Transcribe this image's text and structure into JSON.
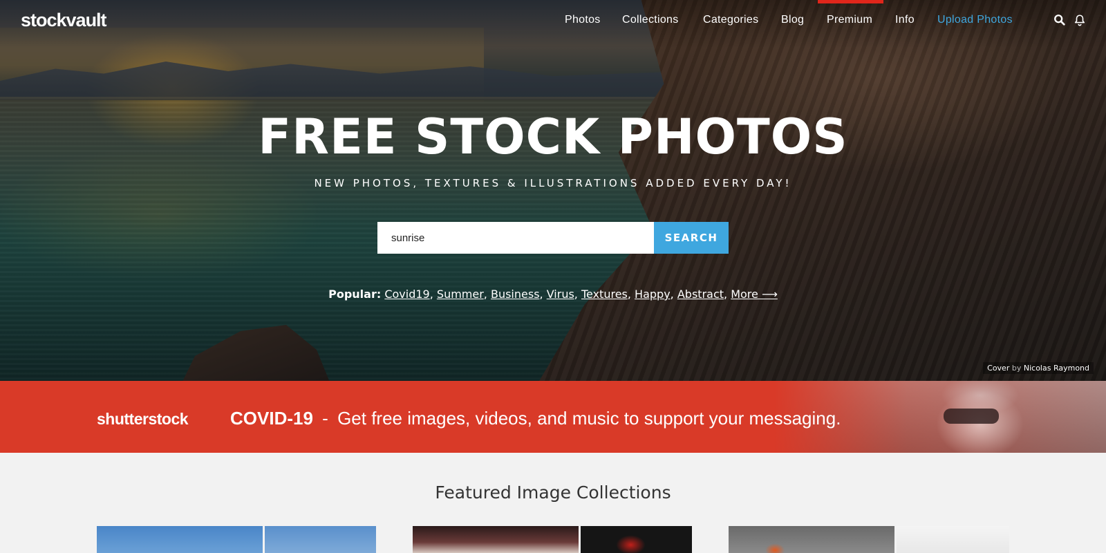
{
  "header": {
    "logo": "stockvault",
    "nav": [
      {
        "label": "Photos"
      },
      {
        "label": "Collections"
      },
      {
        "label": "Categories"
      },
      {
        "label": "Blog"
      },
      {
        "label": "Premium"
      },
      {
        "label": "Info"
      },
      {
        "label": "Upload Photos"
      }
    ],
    "icons": [
      "search-icon",
      "bell-icon"
    ],
    "accent_color": "#3fa7df",
    "premium_marker_color": "#e0261b"
  },
  "hero": {
    "title": "FREE STOCK PHOTOS",
    "subtitle": "NEW PHOTOS, TEXTURES & ILLUSTRATIONS ADDED EVERY DAY!",
    "search": {
      "value": "sunrise",
      "button": "SEARCH"
    },
    "popular": {
      "label": "Popular:",
      "tags": [
        "Covid19",
        "Summer",
        "Business",
        "Virus",
        "Textures",
        "Happy",
        "Abstract",
        "More ⟶"
      ]
    },
    "cover_credit": {
      "prefix": "Cover",
      "by": "by",
      "author": "Nicolas Raymond"
    }
  },
  "banner": {
    "brand": "shutterstock",
    "headline": "COVID-19",
    "separator": "-",
    "message": "Get free images, videos, and music to support your messaging.",
    "background": "#d93a28"
  },
  "featured": {
    "title": "Featured Image Collections"
  }
}
